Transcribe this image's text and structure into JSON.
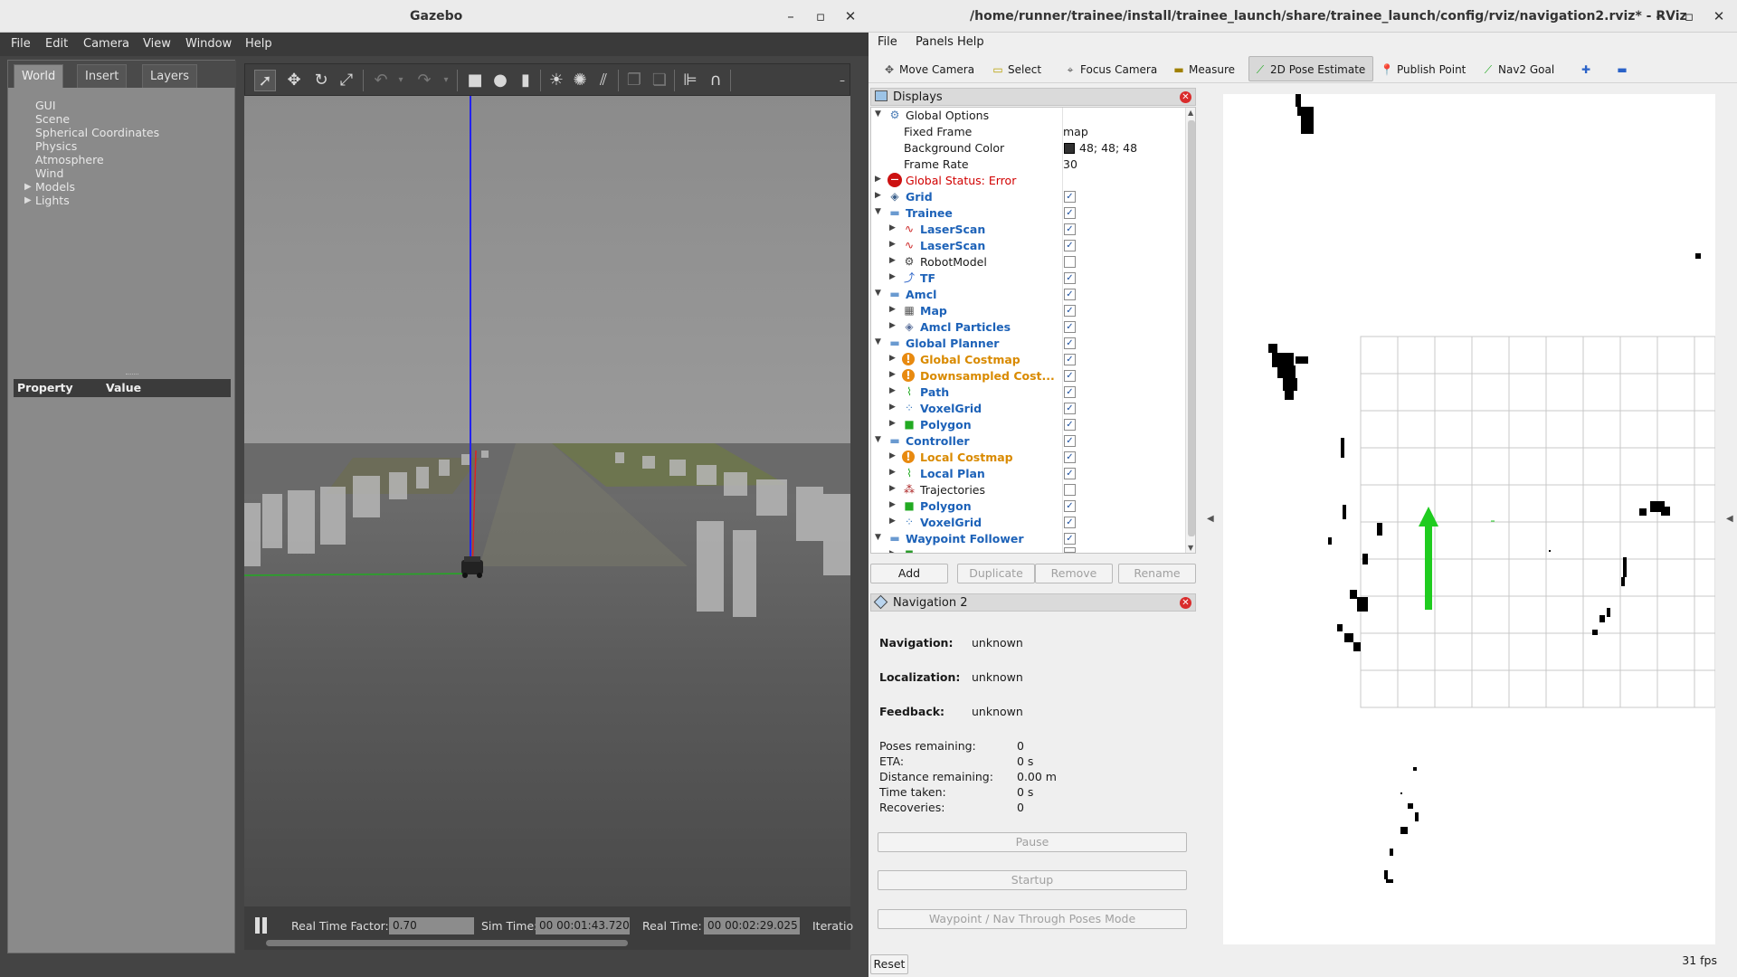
{
  "gazebo": {
    "title": "Gazebo",
    "menu": [
      "File",
      "Edit",
      "Camera",
      "View",
      "Window",
      "Help"
    ],
    "tabs": [
      "World",
      "Insert",
      "Layers"
    ],
    "active_tab": "World",
    "tree": [
      {
        "label": "GUI",
        "expandable": false
      },
      {
        "label": "Scene",
        "expandable": false
      },
      {
        "label": "Spherical Coordinates",
        "expandable": false
      },
      {
        "label": "Physics",
        "expandable": false
      },
      {
        "label": "Atmosphere",
        "expandable": false
      },
      {
        "label": "Wind",
        "expandable": false
      },
      {
        "label": "Models",
        "expandable": true
      },
      {
        "label": "Lights",
        "expandable": true
      }
    ],
    "property_header": {
      "property": "Property",
      "value": "Value"
    },
    "toolbar_icons": [
      "select-arrow-icon",
      "translate-icon",
      "rotate-icon",
      "scale-icon",
      "undo-icon",
      "redo-icon",
      "box-icon",
      "sphere-icon",
      "cylinder-icon",
      "point-light-icon",
      "spot-light-icon",
      "directional-light-icon",
      "copy-icon",
      "paste-icon",
      "align-icon",
      "snap-icon"
    ],
    "status": {
      "real_time_factor_label": "Real Time Factor:",
      "real_time_factor": "0.70",
      "sim_time_label": "Sim Time:",
      "sim_time": "00 00:01:43.720",
      "real_time_label": "Real Time:",
      "real_time": "00 00:02:29.025",
      "iterations_label": "Iteratio"
    }
  },
  "rviz": {
    "title": "/home/runner/trainee/install/trainee_launch/share/trainee_launch/config/rviz/navigation2.rviz* - RViz",
    "menu": [
      "File",
      "Panels",
      "Help"
    ],
    "tools": [
      {
        "label": "Move Camera",
        "icon": "move-camera-icon",
        "active": false
      },
      {
        "label": "Select",
        "icon": "select-icon",
        "active": false
      },
      {
        "label": "Focus Camera",
        "icon": "focus-camera-icon",
        "active": false
      },
      {
        "label": "Measure",
        "icon": "measure-icon",
        "active": false
      },
      {
        "label": "2D Pose Estimate",
        "icon": "pose-estimate-icon",
        "active": true
      },
      {
        "label": "Publish Point",
        "icon": "publish-point-icon",
        "active": false
      },
      {
        "label": "Nav2 Goal",
        "icon": "nav2-goal-icon",
        "active": false
      }
    ],
    "displays": {
      "title": "Displays",
      "global_options": {
        "label": "Global Options",
        "fixed_frame_label": "Fixed Frame",
        "fixed_frame": "map",
        "background_color_label": "Background Color",
        "background_color": "48; 48; 48",
        "frame_rate_label": "Frame Rate",
        "frame_rate": "30"
      },
      "global_status": "Global Status: Error",
      "items": [
        {
          "label": "Grid",
          "level": 0,
          "style": "blue",
          "icon": "grid-icon",
          "checked": true,
          "expanded": false
        },
        {
          "label": "Trainee",
          "level": 0,
          "style": "blue",
          "icon": "folder-icon",
          "checked": true,
          "expanded": true
        },
        {
          "label": "LaserScan",
          "level": 1,
          "style": "blue",
          "icon": "laser-scan-icon",
          "checked": true
        },
        {
          "label": "LaserScan",
          "level": 1,
          "style": "blue",
          "icon": "laser-scan-icon",
          "checked": true
        },
        {
          "label": "RobotModel",
          "level": 1,
          "style": "normal",
          "icon": "robot-model-icon",
          "checked": false
        },
        {
          "label": "TF",
          "level": 1,
          "style": "blue",
          "icon": "tf-icon",
          "checked": true
        },
        {
          "label": "Amcl",
          "level": 0,
          "style": "blue",
          "icon": "folder-icon",
          "checked": true,
          "expanded": true
        },
        {
          "label": "Map",
          "level": 1,
          "style": "blue",
          "icon": "map-icon",
          "checked": true
        },
        {
          "label": "Amcl Particles",
          "level": 1,
          "style": "blue",
          "icon": "particles-icon",
          "checked": true
        },
        {
          "label": "Global Planner",
          "level": 0,
          "style": "blue",
          "icon": "folder-icon",
          "checked": true,
          "expanded": true
        },
        {
          "label": "Global Costmap",
          "level": 1,
          "style": "orange",
          "icon": "warning-icon",
          "checked": true
        },
        {
          "label": "Downsampled Cost...",
          "level": 1,
          "style": "orange",
          "icon": "warning-icon",
          "checked": true
        },
        {
          "label": "Path",
          "level": 1,
          "style": "blue",
          "icon": "path-icon",
          "checked": true
        },
        {
          "label": "VoxelGrid",
          "level": 1,
          "style": "blue",
          "icon": "voxel-grid-icon",
          "checked": true
        },
        {
          "label": "Polygon",
          "level": 1,
          "style": "blue",
          "icon": "polygon-icon",
          "checked": true
        },
        {
          "label": "Controller",
          "level": 0,
          "style": "blue",
          "icon": "folder-icon",
          "checked": true,
          "expanded": true
        },
        {
          "label": "Local Costmap",
          "level": 1,
          "style": "orange",
          "icon": "warning-icon",
          "checked": true
        },
        {
          "label": "Local Plan",
          "level": 1,
          "style": "blue",
          "icon": "path-icon",
          "checked": true
        },
        {
          "label": "Trajectories",
          "level": 1,
          "style": "normal",
          "icon": "trajectories-icon",
          "checked": false
        },
        {
          "label": "Polygon",
          "level": 1,
          "style": "blue",
          "icon": "polygon-icon",
          "checked": true
        },
        {
          "label": "VoxelGrid",
          "level": 1,
          "style": "blue",
          "icon": "voxel-grid-icon",
          "checked": true
        },
        {
          "label": "Waypoint Follower",
          "level": 0,
          "style": "blue",
          "icon": "folder-icon",
          "checked": true,
          "expanded": true
        }
      ],
      "buttons": [
        "Add",
        "Duplicate",
        "Remove",
        "Rename"
      ]
    },
    "nav2_panel": {
      "title": "Navigation 2",
      "navigation_label": "Navigation:",
      "navigation": "unknown",
      "localization_label": "Localization:",
      "localization": "unknown",
      "feedback_label": "Feedback:",
      "feedback": "unknown",
      "stats": [
        {
          "label": "Poses remaining:",
          "value": "0"
        },
        {
          "label": "ETA:",
          "value": "0 s"
        },
        {
          "label": "Distance remaining:",
          "value": "0.00 m"
        },
        {
          "label": "Time taken:",
          "value": "0 s"
        },
        {
          "label": "Recoveries:",
          "value": "0"
        }
      ],
      "pause_label": "Pause",
      "startup_label": "Startup",
      "waypoint_mode_label": "Waypoint / Nav Through Poses Mode"
    },
    "reset_label": "Reset",
    "fps": "31 fps"
  }
}
